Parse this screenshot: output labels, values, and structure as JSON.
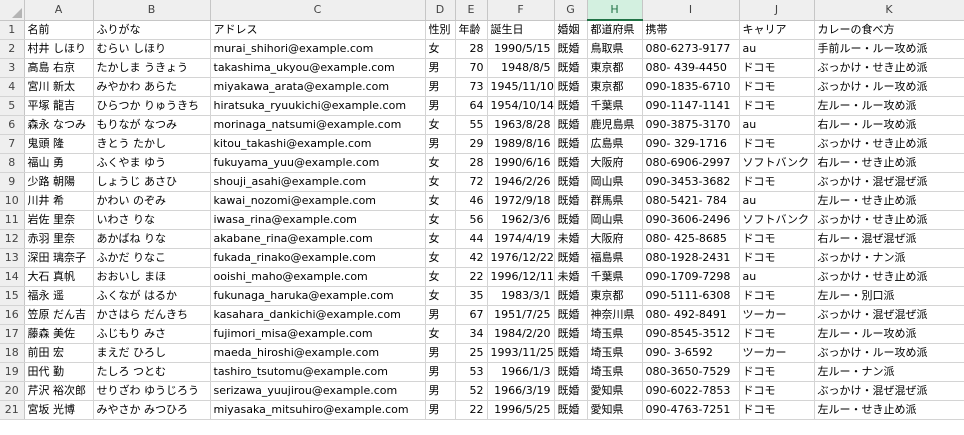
{
  "spreadsheet": {
    "columns": [
      "A",
      "B",
      "C",
      "D",
      "E",
      "F",
      "G",
      "H",
      "I",
      "J",
      "K"
    ],
    "selected_column": "H",
    "header_row": [
      "名前",
      "ふりがな",
      "アドレス",
      "性別",
      "年齢",
      "誕生日",
      "婚姻",
      "都道府県",
      "携帯",
      "キャリア",
      "カレーの食べ方"
    ],
    "rows": [
      [
        "村井 しほり",
        "むらい しほり",
        "murai_shihori@example.com",
        "女",
        "28",
        "1990/5/15",
        "既婚",
        "鳥取県",
        "080-6273-9177",
        "au",
        "手前ルー・ルー攻め派"
      ],
      [
        "高島 右京",
        "たかしま うきょう",
        "takashima_ukyou@example.com",
        "男",
        "70",
        "1948/8/5",
        "既婚",
        "東京都",
        "080- 439-4450",
        "ドコモ",
        "ぶっかけ・せき止め派"
      ],
      [
        "宮川 新太",
        "みやかわ あらた",
        "miyakawa_arata@example.com",
        "男",
        "73",
        "1945/11/10",
        "既婚",
        "東京都",
        "090-1835-6710",
        "ドコモ",
        "ぶっかけ・ルー攻め派"
      ],
      [
        "平塚 龍吉",
        "ひらつか りゅうきち",
        "hiratsuka_ryuukichi@example.com",
        "男",
        "64",
        "1954/10/14",
        "既婚",
        "千葉県",
        "090-1147-1141",
        "ドコモ",
        "左ルー・ルー攻め派"
      ],
      [
        "森永 なつみ",
        "もりなが なつみ",
        "morinaga_natsumi@example.com",
        "女",
        "55",
        "1963/8/28",
        "既婚",
        "鹿児島県",
        "090-3875-3170",
        "au",
        "右ルー・ルー攻め派"
      ],
      [
        "鬼頭 隆",
        "きとう たかし",
        "kitou_takashi@example.com",
        "男",
        "29",
        "1989/8/16",
        "既婚",
        "広島県",
        "090- 329-1716",
        "ドコモ",
        "ぶっかけ・せき止め派"
      ],
      [
        "福山 勇",
        "ふくやま ゆう",
        "fukuyama_yuu@example.com",
        "女",
        "28",
        "1990/6/16",
        "既婚",
        "大阪府",
        "080-6906-2997",
        "ソフトバンク",
        "右ルー・せき止め派"
      ],
      [
        "少路 朝陽",
        "しょうじ あさひ",
        "shouji_asahi@example.com",
        "女",
        "72",
        "1946/2/26",
        "既婚",
        "岡山県",
        "090-3453-3682",
        "ドコモ",
        "ぶっかけ・混ぜ混ぜ派"
      ],
      [
        "川井 希",
        "かわい のぞみ",
        "kawai_nozomi@example.com",
        "女",
        "46",
        "1972/9/18",
        "既婚",
        "群馬県",
        "080-5421- 784",
        "au",
        "左ルー・せき止め派"
      ],
      [
        "岩佐 里奈",
        "いわさ りな",
        "iwasa_rina@example.com",
        "女",
        "56",
        "1962/3/6",
        "既婚",
        "岡山県",
        "090-3606-2496",
        "ソフトバンク",
        "ぶっかけ・せき止め派"
      ],
      [
        "赤羽 里奈",
        "あかばね りな",
        "akabane_rina@example.com",
        "女",
        "44",
        "1974/4/19",
        "未婚",
        "大阪府",
        "080- 425-8685",
        "ドコモ",
        "右ルー・混ぜ混ぜ派"
      ],
      [
        "深田 璃奈子",
        "ふかだ りなこ",
        "fukada_rinako@example.com",
        "女",
        "42",
        "1976/12/22",
        "既婚",
        "福島県",
        "080-1928-2431",
        "ドコモ",
        "ぶっかけ・ナン派"
      ],
      [
        "大石 真帆",
        "おおいし まほ",
        "ooishi_maho@example.com",
        "女",
        "22",
        "1996/12/11",
        "未婚",
        "千葉県",
        "090-1709-7298",
        "au",
        "ぶっかけ・せき止め派"
      ],
      [
        "福永 遥",
        "ふくなが はるか",
        "fukunaga_haruka@example.com",
        "女",
        "35",
        "1983/3/1",
        "既婚",
        "東京都",
        "090-5111-6308",
        "ドコモ",
        "左ルー・別口派"
      ],
      [
        "笠原 だん吉",
        "かさはら だんきち",
        "kasahara_dankichi@example.com",
        "男",
        "67",
        "1951/7/25",
        "既婚",
        "神奈川県",
        "080- 492-8491",
        "ツーカー",
        "ぶっかけ・混ぜ混ぜ派"
      ],
      [
        "藤森 美佐",
        "ふじもり みさ",
        "fujimori_misa@example.com",
        "女",
        "34",
        "1984/2/20",
        "既婚",
        "埼玉県",
        "090-8545-3512",
        "ドコモ",
        "左ルー・ルー攻め派"
      ],
      [
        "前田 宏",
        "まえだ ひろし",
        "maeda_hiroshi@example.com",
        "男",
        "25",
        "1993/11/25",
        "既婚",
        "埼玉県",
        "090- 3-6592",
        "ツーカー",
        "ぶっかけ・ルー攻め派"
      ],
      [
        "田代 勤",
        "たしろ つとむ",
        "tashiro_tsutomu@example.com",
        "男",
        "53",
        "1966/1/3",
        "既婚",
        "埼玉県",
        "080-3650-7529",
        "ドコモ",
        "左ルー・ナン派"
      ],
      [
        "芹沢 裕次郎",
        "せりざわ ゆうじろう",
        "serizawa_yuujirou@example.com",
        "男",
        "52",
        "1966/3/19",
        "既婚",
        "愛知県",
        "090-6022-7853",
        "ドコモ",
        "ぶっかけ・混ぜ混ぜ派"
      ],
      [
        "宮坂 光博",
        "みやさか みつひろ",
        "miyasaka_mitsuhiro@example.com",
        "男",
        "22",
        "1996/5/25",
        "既婚",
        "愛知県",
        "090-4763-7251",
        "ドコモ",
        "左ルー・せき止め派"
      ]
    ]
  }
}
